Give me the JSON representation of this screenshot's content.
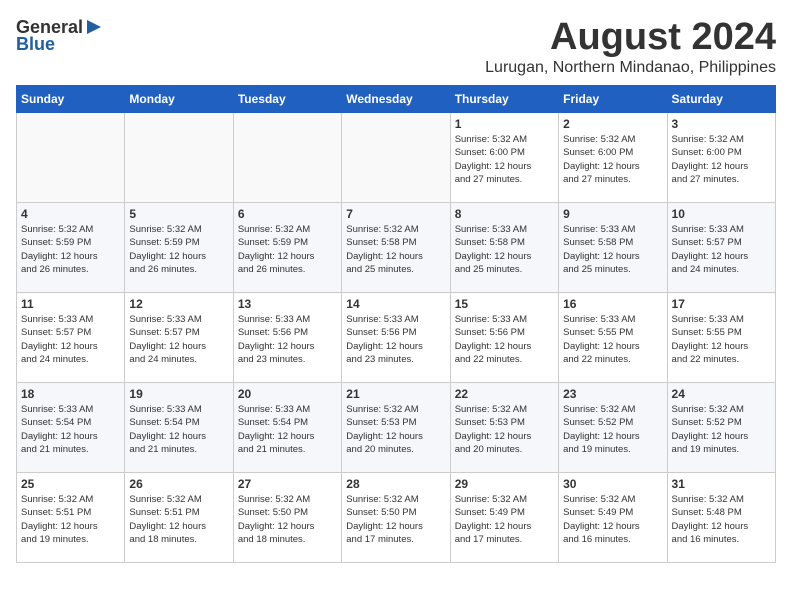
{
  "header": {
    "logo_general": "General",
    "logo_blue": "Blue",
    "month_title": "August 2024",
    "location": "Lurugan, Northern Mindanao, Philippines"
  },
  "days_of_week": [
    "Sunday",
    "Monday",
    "Tuesday",
    "Wednesday",
    "Thursday",
    "Friday",
    "Saturday"
  ],
  "weeks": [
    [
      {
        "day": "",
        "content": ""
      },
      {
        "day": "",
        "content": ""
      },
      {
        "day": "",
        "content": ""
      },
      {
        "day": "",
        "content": ""
      },
      {
        "day": "1",
        "content": "Sunrise: 5:32 AM\nSunset: 6:00 PM\nDaylight: 12 hours\nand 27 minutes."
      },
      {
        "day": "2",
        "content": "Sunrise: 5:32 AM\nSunset: 6:00 PM\nDaylight: 12 hours\nand 27 minutes."
      },
      {
        "day": "3",
        "content": "Sunrise: 5:32 AM\nSunset: 6:00 PM\nDaylight: 12 hours\nand 27 minutes."
      }
    ],
    [
      {
        "day": "4",
        "content": "Sunrise: 5:32 AM\nSunset: 5:59 PM\nDaylight: 12 hours\nand 26 minutes."
      },
      {
        "day": "5",
        "content": "Sunrise: 5:32 AM\nSunset: 5:59 PM\nDaylight: 12 hours\nand 26 minutes."
      },
      {
        "day": "6",
        "content": "Sunrise: 5:32 AM\nSunset: 5:59 PM\nDaylight: 12 hours\nand 26 minutes."
      },
      {
        "day": "7",
        "content": "Sunrise: 5:32 AM\nSunset: 5:58 PM\nDaylight: 12 hours\nand 25 minutes."
      },
      {
        "day": "8",
        "content": "Sunrise: 5:33 AM\nSunset: 5:58 PM\nDaylight: 12 hours\nand 25 minutes."
      },
      {
        "day": "9",
        "content": "Sunrise: 5:33 AM\nSunset: 5:58 PM\nDaylight: 12 hours\nand 25 minutes."
      },
      {
        "day": "10",
        "content": "Sunrise: 5:33 AM\nSunset: 5:57 PM\nDaylight: 12 hours\nand 24 minutes."
      }
    ],
    [
      {
        "day": "11",
        "content": "Sunrise: 5:33 AM\nSunset: 5:57 PM\nDaylight: 12 hours\nand 24 minutes."
      },
      {
        "day": "12",
        "content": "Sunrise: 5:33 AM\nSunset: 5:57 PM\nDaylight: 12 hours\nand 24 minutes."
      },
      {
        "day": "13",
        "content": "Sunrise: 5:33 AM\nSunset: 5:56 PM\nDaylight: 12 hours\nand 23 minutes."
      },
      {
        "day": "14",
        "content": "Sunrise: 5:33 AM\nSunset: 5:56 PM\nDaylight: 12 hours\nand 23 minutes."
      },
      {
        "day": "15",
        "content": "Sunrise: 5:33 AM\nSunset: 5:56 PM\nDaylight: 12 hours\nand 22 minutes."
      },
      {
        "day": "16",
        "content": "Sunrise: 5:33 AM\nSunset: 5:55 PM\nDaylight: 12 hours\nand 22 minutes."
      },
      {
        "day": "17",
        "content": "Sunrise: 5:33 AM\nSunset: 5:55 PM\nDaylight: 12 hours\nand 22 minutes."
      }
    ],
    [
      {
        "day": "18",
        "content": "Sunrise: 5:33 AM\nSunset: 5:54 PM\nDaylight: 12 hours\nand 21 minutes."
      },
      {
        "day": "19",
        "content": "Sunrise: 5:33 AM\nSunset: 5:54 PM\nDaylight: 12 hours\nand 21 minutes."
      },
      {
        "day": "20",
        "content": "Sunrise: 5:33 AM\nSunset: 5:54 PM\nDaylight: 12 hours\nand 21 minutes."
      },
      {
        "day": "21",
        "content": "Sunrise: 5:32 AM\nSunset: 5:53 PM\nDaylight: 12 hours\nand 20 minutes."
      },
      {
        "day": "22",
        "content": "Sunrise: 5:32 AM\nSunset: 5:53 PM\nDaylight: 12 hours\nand 20 minutes."
      },
      {
        "day": "23",
        "content": "Sunrise: 5:32 AM\nSunset: 5:52 PM\nDaylight: 12 hours\nand 19 minutes."
      },
      {
        "day": "24",
        "content": "Sunrise: 5:32 AM\nSunset: 5:52 PM\nDaylight: 12 hours\nand 19 minutes."
      }
    ],
    [
      {
        "day": "25",
        "content": "Sunrise: 5:32 AM\nSunset: 5:51 PM\nDaylight: 12 hours\nand 19 minutes."
      },
      {
        "day": "26",
        "content": "Sunrise: 5:32 AM\nSunset: 5:51 PM\nDaylight: 12 hours\nand 18 minutes."
      },
      {
        "day": "27",
        "content": "Sunrise: 5:32 AM\nSunset: 5:50 PM\nDaylight: 12 hours\nand 18 minutes."
      },
      {
        "day": "28",
        "content": "Sunrise: 5:32 AM\nSunset: 5:50 PM\nDaylight: 12 hours\nand 17 minutes."
      },
      {
        "day": "29",
        "content": "Sunrise: 5:32 AM\nSunset: 5:49 PM\nDaylight: 12 hours\nand 17 minutes."
      },
      {
        "day": "30",
        "content": "Sunrise: 5:32 AM\nSunset: 5:49 PM\nDaylight: 12 hours\nand 16 minutes."
      },
      {
        "day": "31",
        "content": "Sunrise: 5:32 AM\nSunset: 5:48 PM\nDaylight: 12 hours\nand 16 minutes."
      }
    ]
  ]
}
